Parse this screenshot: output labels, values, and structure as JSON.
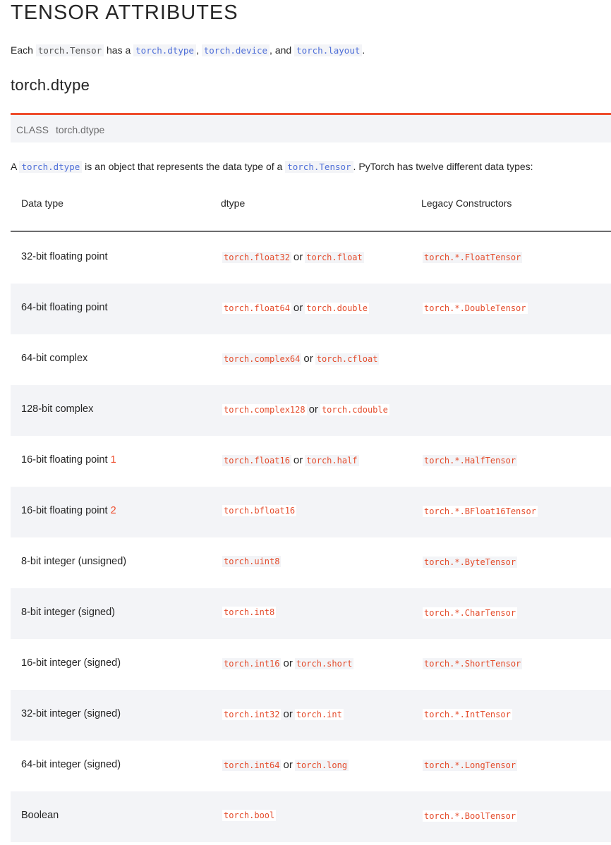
{
  "title": "TENSOR ATTRIBUTES",
  "intro": {
    "prefix": "Each",
    "tensor": "torch.Tensor",
    "has_a": "has a",
    "dtype": "torch.dtype",
    "sep": ",",
    "device": "torch.device",
    "and": ", and",
    "layout": "torch.layout",
    "end": "."
  },
  "section_title": "torch.dtype",
  "class_box": {
    "keyword": "CLASS",
    "name": "torch.dtype"
  },
  "description": {
    "a": "A",
    "dtype": "torch.dtype",
    "middle": "is an object that represents the data type of a",
    "tensor": "torch.Tensor",
    "end": ". PyTorch has twelve different data types:"
  },
  "table": {
    "headers": [
      "Data type",
      "dtype",
      "Legacy Constructors"
    ],
    "or_word": "or",
    "rows": [
      {
        "type": "32-bit floating point",
        "footnote": "",
        "dtype": "torch.float32",
        "alias": "torch.float",
        "legacy": "torch.*.FloatTensor"
      },
      {
        "type": "64-bit floating point",
        "footnote": "",
        "dtype": "torch.float64",
        "alias": "torch.double",
        "legacy": "torch.*.DoubleTensor"
      },
      {
        "type": "64-bit complex",
        "footnote": "",
        "dtype": "torch.complex64",
        "alias": "torch.cfloat",
        "legacy": ""
      },
      {
        "type": "128-bit complex",
        "footnote": "",
        "dtype": "torch.complex128",
        "alias": "torch.cdouble",
        "legacy": ""
      },
      {
        "type": "16-bit floating point",
        "footnote": "1",
        "dtype": "torch.float16",
        "alias": "torch.half",
        "legacy": "torch.*.HalfTensor"
      },
      {
        "type": "16-bit floating point",
        "footnote": "2",
        "dtype": "torch.bfloat16",
        "alias": "",
        "legacy": "torch.*.BFloat16Tensor"
      },
      {
        "type": "8-bit integer (unsigned)",
        "footnote": "",
        "dtype": "torch.uint8",
        "alias": "",
        "legacy": "torch.*.ByteTensor"
      },
      {
        "type": "8-bit integer (signed)",
        "footnote": "",
        "dtype": "torch.int8",
        "alias": "",
        "legacy": "torch.*.CharTensor"
      },
      {
        "type": "16-bit integer (signed)",
        "footnote": "",
        "dtype": "torch.int16",
        "alias": "torch.short",
        "legacy": "torch.*.ShortTensor"
      },
      {
        "type": "32-bit integer (signed)",
        "footnote": "",
        "dtype": "torch.int32",
        "alias": "torch.int",
        "legacy": "torch.*.IntTensor"
      },
      {
        "type": "64-bit integer (signed)",
        "footnote": "",
        "dtype": "torch.int64",
        "alias": "torch.long",
        "legacy": "torch.*.LongTensor"
      },
      {
        "type": "Boolean",
        "footnote": "",
        "dtype": "torch.bool",
        "alias": "",
        "legacy": "torch.*.BoolTensor"
      }
    ]
  },
  "colors": {
    "accent": "#ee4c2c",
    "link": "#4f6fd8",
    "code_red": "#e44c2c",
    "stripe": "#f3f4f7"
  }
}
